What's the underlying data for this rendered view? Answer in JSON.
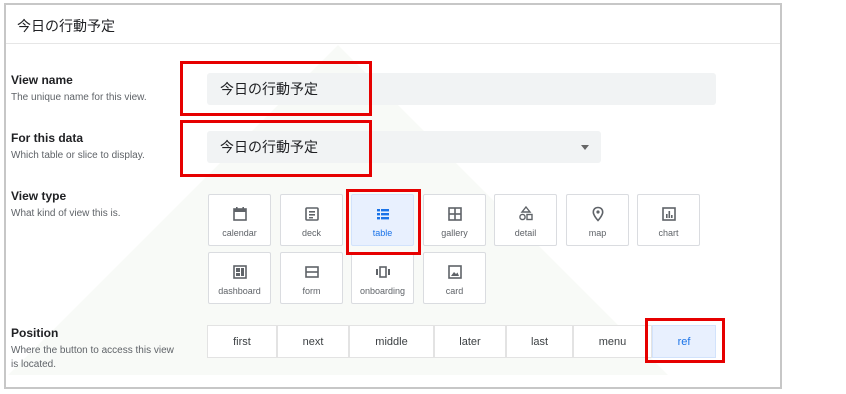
{
  "header": {
    "title": "今日の行動予定"
  },
  "view_name": {
    "label": "View name",
    "description": "The unique name for this view.",
    "value": "今日の行動予定"
  },
  "for_this_data": {
    "label": "For this data",
    "description": "Which table or slice to display.",
    "value": "今日の行動予定"
  },
  "view_type": {
    "label": "View type",
    "description": "What kind of view this is.",
    "options": [
      {
        "label": "calendar",
        "icon": "calendar-icon"
      },
      {
        "label": "deck",
        "icon": "deck-icon"
      },
      {
        "label": "table",
        "icon": "table-icon",
        "selected": true
      },
      {
        "label": "gallery",
        "icon": "gallery-icon"
      },
      {
        "label": "detail",
        "icon": "detail-icon"
      },
      {
        "label": "map",
        "icon": "map-pin-icon"
      },
      {
        "label": "chart",
        "icon": "chart-icon"
      },
      {
        "label": "dashboard",
        "icon": "dashboard-icon"
      },
      {
        "label": "form",
        "icon": "form-icon"
      },
      {
        "label": "onboarding",
        "icon": "onboarding-icon"
      },
      {
        "label": "card",
        "icon": "card-icon"
      }
    ]
  },
  "position": {
    "label": "Position",
    "description": "Where the button to access this view is located.",
    "options": [
      "first",
      "next",
      "middle",
      "later",
      "last",
      "menu",
      "ref"
    ],
    "selected": "ref"
  },
  "colors": {
    "highlight": "#e60000",
    "accent": "#1a73e8",
    "selected_bg": "#e8f0fe"
  }
}
